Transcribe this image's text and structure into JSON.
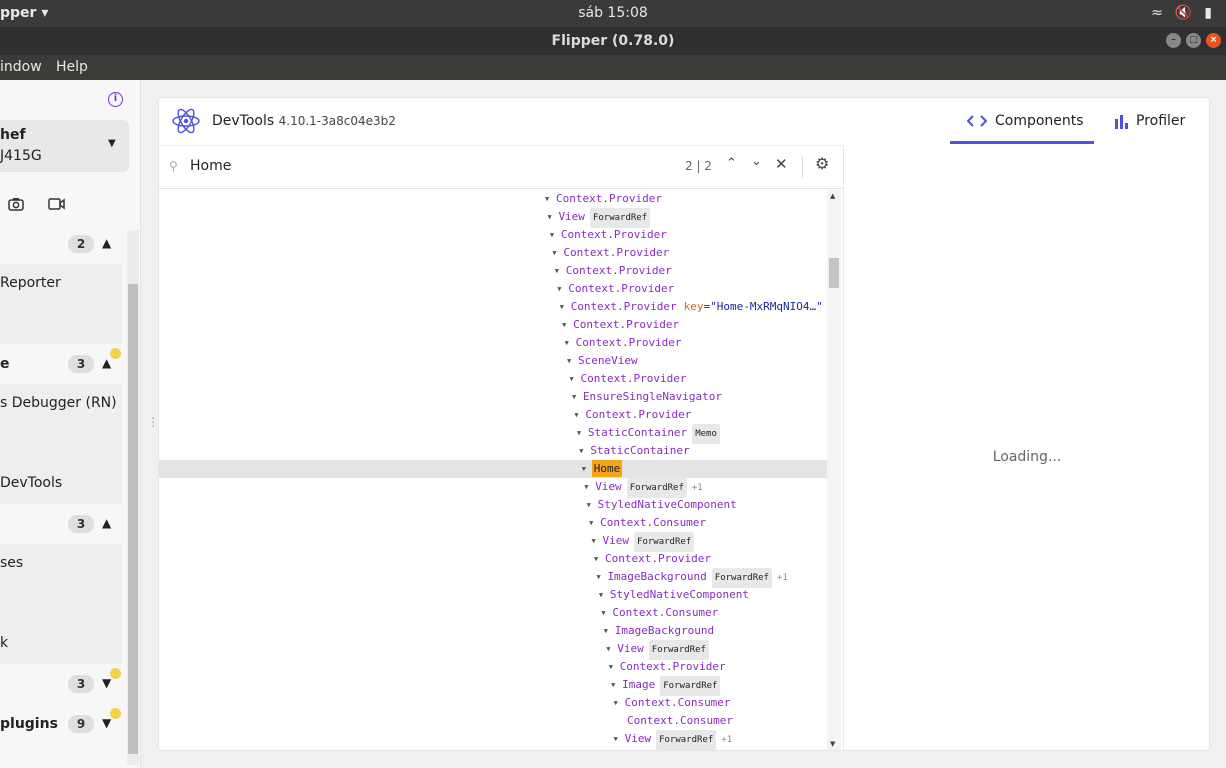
{
  "system": {
    "app_menu": "pper ▾",
    "clock": "sáb 15:08"
  },
  "window": {
    "title": "Flipper (0.78.0)"
  },
  "menubar": {
    "items": [
      "indow",
      "Help"
    ]
  },
  "sidebar": {
    "device_name": "hef",
    "device_model": "J415G",
    "groups": [
      {
        "count": "2",
        "items": [
          "Reporter"
        ]
      },
      {
        "label": "e",
        "count": "3",
        "items": [
          "s Debugger (RN)",
          "DevTools"
        ]
      },
      {
        "count": "3",
        "items": [
          "ses",
          "k"
        ]
      },
      {
        "count": "3"
      },
      {
        "label": "plugins",
        "count": "9"
      }
    ]
  },
  "devtools": {
    "name": "DevTools",
    "version": "4.10.1-3a8c04e3b2",
    "tabs": [
      {
        "label": "Components",
        "active": true
      },
      {
        "label": "Profiler",
        "active": false
      }
    ],
    "search": {
      "value": "Home",
      "count": "2 | 2"
    },
    "loading": "Loading..."
  },
  "tree": [
    {
      "d": 0,
      "n": "Context.Provider"
    },
    {
      "d": 1,
      "n": "View",
      "t": "ForwardRef"
    },
    {
      "d": 2,
      "n": "Context.Provider"
    },
    {
      "d": 3,
      "n": "Context.Provider"
    },
    {
      "d": 4,
      "n": "Context.Provider"
    },
    {
      "d": 5,
      "n": "Context.Provider"
    },
    {
      "d": 6,
      "n": "Context.Provider",
      "k": "key",
      "v": "\"Home-MxRMqNIO4…\""
    },
    {
      "d": 7,
      "n": "Context.Provider"
    },
    {
      "d": 8,
      "n": "Context.Provider"
    },
    {
      "d": 9,
      "n": "SceneView"
    },
    {
      "d": 10,
      "n": "Context.Provider"
    },
    {
      "d": 11,
      "n": "EnsureSingleNavigator"
    },
    {
      "d": 12,
      "n": "Context.Provider"
    },
    {
      "d": 13,
      "n": "StaticContainer",
      "t": "Memo"
    },
    {
      "d": 14,
      "n": "StaticContainer"
    },
    {
      "d": 15,
      "n": "Home",
      "sel": true
    },
    {
      "d": 16,
      "n": "View",
      "t": "ForwardRef",
      "x": "+1"
    },
    {
      "d": 17,
      "n": "StyledNativeComponent"
    },
    {
      "d": 18,
      "n": "Context.Consumer"
    },
    {
      "d": 19,
      "n": "View",
      "t": "ForwardRef"
    },
    {
      "d": 20,
      "n": "Context.Provider"
    },
    {
      "d": 21,
      "n": "ImageBackground",
      "t": "ForwardRef",
      "x": "+1"
    },
    {
      "d": 22,
      "n": "StyledNativeComponent"
    },
    {
      "d": 23,
      "n": "Context.Consumer"
    },
    {
      "d": 24,
      "n": "ImageBackground"
    },
    {
      "d": 25,
      "n": "View",
      "t": "ForwardRef"
    },
    {
      "d": 26,
      "n": "Context.Provider"
    },
    {
      "d": 27,
      "n": "Image",
      "t": "ForwardRef"
    },
    {
      "d": 28,
      "n": "Context.Consumer"
    },
    {
      "d": 29,
      "n": "Context.Consumer",
      "leaf": true
    },
    {
      "d": 28,
      "n": "View",
      "t": "ForwardRef",
      "x": "+1"
    }
  ],
  "colors": {
    "accent": "#4f4fe0",
    "component": "#8a2cbd",
    "highlight": "#f7a21b",
    "attr_key": "#d26a1e",
    "attr_value": "#1b2a9a",
    "notification": "#f5d04a"
  },
  "icons": [
    "info-icon",
    "camera-icon",
    "video-icon",
    "search-icon",
    "chevron-up-icon",
    "chevron-down-icon",
    "close-icon",
    "gear-icon",
    "react-logo-icon",
    "code-icon",
    "bar-chart-icon",
    "wifi-icon",
    "volume-muted-icon",
    "battery-icon"
  ]
}
